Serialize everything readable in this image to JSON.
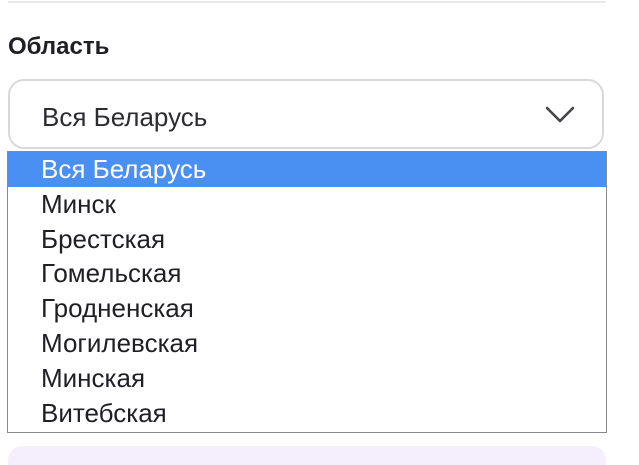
{
  "region_field": {
    "label": "Область",
    "selected_value": "Вся Беларусь",
    "options": [
      "Вся Беларусь",
      "Минск",
      "Брестская",
      "Гомельская",
      "Гродненская",
      "Могилевская",
      "Минская",
      "Витебская"
    ],
    "selected_index": 0
  },
  "colors": {
    "highlight": "#4a90f2",
    "bottom_card": "#f5effd"
  },
  "icons": {
    "dropdown": "chevron-down-icon"
  }
}
